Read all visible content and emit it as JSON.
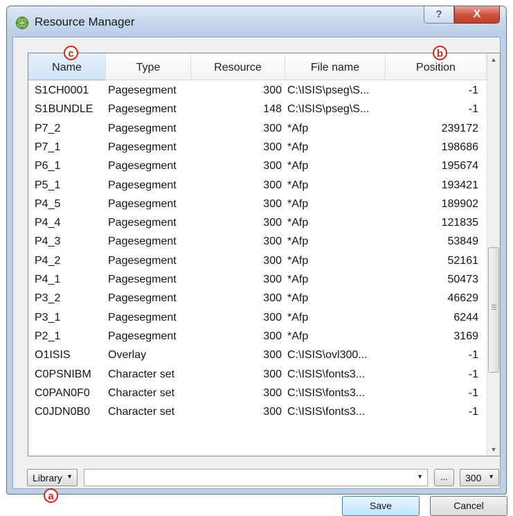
{
  "window": {
    "title": "Resource Manager",
    "help_label": "?",
    "close_label": "X"
  },
  "columns": [
    "Name",
    "Type",
    "Resource",
    "File name",
    "Position"
  ],
  "rows": [
    {
      "name": "S1CH0001",
      "type": "Pagesegment",
      "resource": "300",
      "file": "C:\\ISIS\\pseg\\S...",
      "position": "-1"
    },
    {
      "name": "S1BUNDLE",
      "type": "Pagesegment",
      "resource": "148",
      "file": "C:\\ISIS\\pseg\\S...",
      "position": "-1"
    },
    {
      "name": "P7_2",
      "type": "Pagesegment",
      "resource": "300",
      "file": "*Afp",
      "position": "239172"
    },
    {
      "name": "P7_1",
      "type": "Pagesegment",
      "resource": "300",
      "file": "*Afp",
      "position": "198686"
    },
    {
      "name": "P6_1",
      "type": "Pagesegment",
      "resource": "300",
      "file": "*Afp",
      "position": "195674"
    },
    {
      "name": "P5_1",
      "type": "Pagesegment",
      "resource": "300",
      "file": "*Afp",
      "position": "193421"
    },
    {
      "name": "P4_5",
      "type": "Pagesegment",
      "resource": "300",
      "file": "*Afp",
      "position": "189902"
    },
    {
      "name": "P4_4",
      "type": "Pagesegment",
      "resource": "300",
      "file": "*Afp",
      "position": "121835"
    },
    {
      "name": "P4_3",
      "type": "Pagesegment",
      "resource": "300",
      "file": "*Afp",
      "position": "53849"
    },
    {
      "name": "P4_2",
      "type": "Pagesegment",
      "resource": "300",
      "file": "*Afp",
      "position": "52161"
    },
    {
      "name": "P4_1",
      "type": "Pagesegment",
      "resource": "300",
      "file": "*Afp",
      "position": "50473"
    },
    {
      "name": "P3_2",
      "type": "Pagesegment",
      "resource": "300",
      "file": "*Afp",
      "position": "46629"
    },
    {
      "name": "P3_1",
      "type": "Pagesegment",
      "resource": "300",
      "file": "*Afp",
      "position": "6244"
    },
    {
      "name": "P2_1",
      "type": "Pagesegment",
      "resource": "300",
      "file": "*Afp",
      "position": "3169"
    },
    {
      "name": "O1ISIS",
      "type": "Overlay",
      "resource": "300",
      "file": "C:\\ISIS\\ovl300...",
      "position": "-1"
    },
    {
      "name": "C0PSNIBM",
      "type": "Character set",
      "resource": "300",
      "file": "C:\\ISIS\\fonts3...",
      "position": "-1"
    },
    {
      "name": "C0PAN0F0",
      "type": "Character set",
      "resource": "300",
      "file": "C:\\ISIS\\fonts3...",
      "position": "-1"
    },
    {
      "name": "C0JDN0B0",
      "type": "Character set",
      "resource": "300",
      "file": "C:\\ISIS\\fonts3...",
      "position": "-1"
    }
  ],
  "annotations": {
    "a": "a",
    "b": "b",
    "c": "c"
  },
  "controls": {
    "library_value": "Library",
    "path_value": "",
    "browse_label": "...",
    "resolution_value": "300",
    "save_label": "Save",
    "cancel_label": "Cancel"
  },
  "icons": {
    "app": "resource-manager-icon",
    "dropdown": "chevron-down-icon"
  },
  "colors": {
    "annotation": "#e02010",
    "sorted_header": "#d3e5f7",
    "close_button": "#c33b23"
  }
}
